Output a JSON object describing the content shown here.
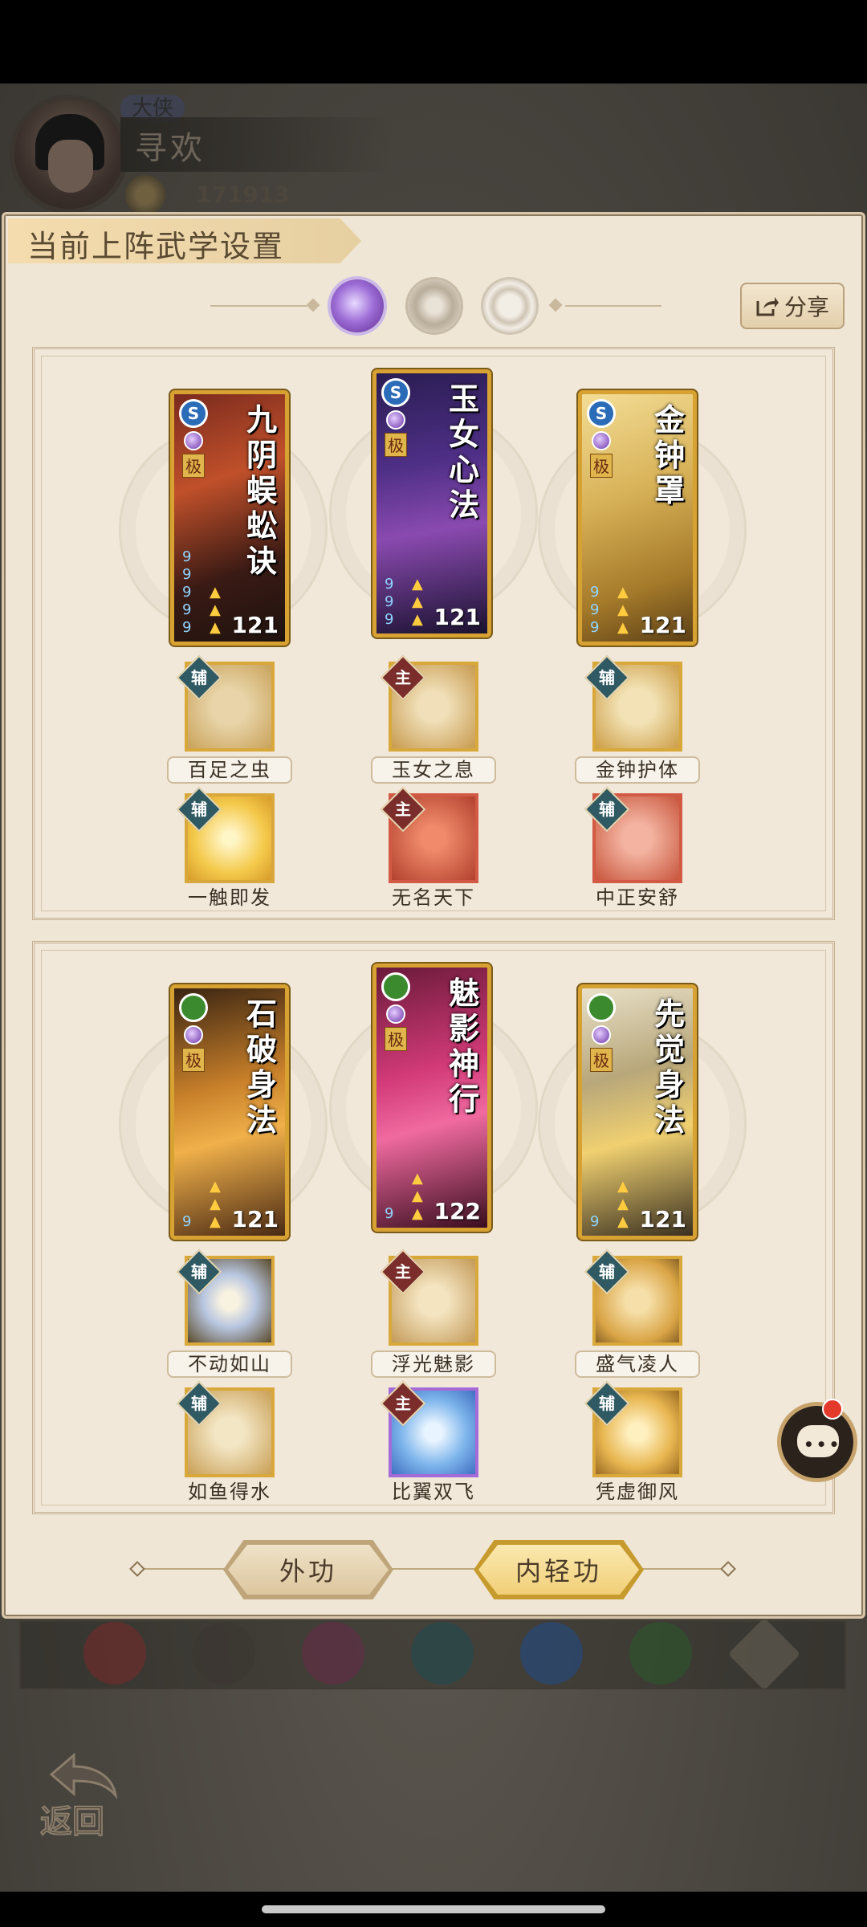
{
  "header": {
    "rank_badge": "大侠",
    "player_name": "寻欢",
    "power": "171913"
  },
  "panel": {
    "title": "当前上阵武学设置",
    "share_label": "分享"
  },
  "groups": [
    {
      "cards": [
        {
          "name": "九阴蜈蚣诀",
          "school": "S",
          "tier": "极",
          "level": "121"
        },
        {
          "name": "玉女心法",
          "school": "S",
          "tier": "极",
          "level": "121"
        },
        {
          "name": "金钟罩",
          "school": "S",
          "tier": "极",
          "level": "121"
        }
      ],
      "skills_row1": [
        {
          "tag": "辅",
          "label": "百足之虫"
        },
        {
          "tag": "主",
          "label": "玉女之息"
        },
        {
          "tag": "辅",
          "label": "金钟护体"
        }
      ],
      "skills_row2": [
        {
          "tag": "辅",
          "label": "一触即发"
        },
        {
          "tag": "主",
          "label": "无名天下"
        },
        {
          "tag": "辅",
          "label": "中正安舒"
        }
      ]
    },
    {
      "cards": [
        {
          "name": "石破身法",
          "school": "",
          "tier": "极",
          "level": "121"
        },
        {
          "name": "魅影神行",
          "school": "",
          "tier": "极",
          "level": "122"
        },
        {
          "name": "先觉身法",
          "school": "",
          "tier": "极",
          "level": "121"
        }
      ],
      "skills_row1": [
        {
          "tag": "辅",
          "label": "不动如山"
        },
        {
          "tag": "主",
          "label": "浮光魅影"
        },
        {
          "tag": "辅",
          "label": "盛气凌人"
        }
      ],
      "skills_row2": [
        {
          "tag": "辅",
          "label": "如鱼得水"
        },
        {
          "tag": "主",
          "label": "比翼双飞"
        },
        {
          "tag": "辅",
          "label": "凭虚御风"
        }
      ]
    }
  ],
  "bottom_tabs": {
    "outer": "外功",
    "inner": "内轻功",
    "active": "inner"
  },
  "nav": {
    "back_label": "返回"
  },
  "colors": {
    "accent_gold": "#d8a232",
    "panel_bg": "#efe6d6",
    "active_tab": "#f5d98a",
    "aux_tag": "#2f5a63",
    "main_tag": "#7a2d2a",
    "notify": "#e33a2c"
  },
  "icons": {
    "tab_1": "moon-icon",
    "tab_2": "gear-icon",
    "tab_3": "ring-icon",
    "share": "share-icon",
    "chat": "chat-icon",
    "back": "back-arrow-icon"
  }
}
